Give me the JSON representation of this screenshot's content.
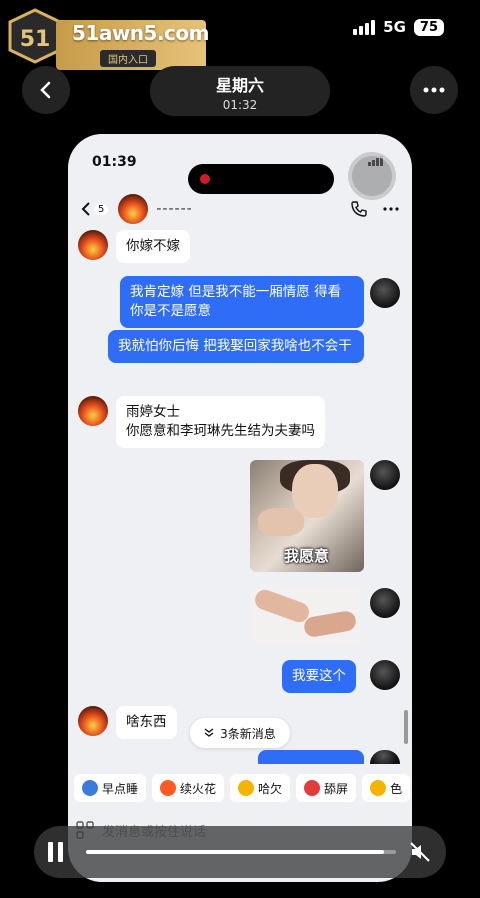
{
  "logo": {
    "text": "51awn5.com",
    "subtitle": "国内入口",
    "badge": "51"
  },
  "status": {
    "network": "5G",
    "battery": "75"
  },
  "header": {
    "title": "星期六",
    "subtitle": "01:32"
  },
  "phone": {
    "status": {
      "time": "01:39"
    },
    "chat": {
      "unread": "5",
      "contact_name": "------",
      "messages": [
        {
          "side": "in",
          "text": "你嫁不嫁"
        },
        {
          "side": "out",
          "text": "我肯定嫁 但是我不能一厢情愿 得看你是不是愿意"
        },
        {
          "side": "out",
          "text": "我就怕你后悔 把我娶回家我啥也不会干"
        },
        {
          "side": "in",
          "text": "雨婷女士\n你愿意和李珂琳先生结为夫妻吗"
        },
        {
          "side": "out",
          "type": "image",
          "caption": "我愿意"
        },
        {
          "side": "out",
          "type": "image"
        },
        {
          "side": "out",
          "text": "我要这个"
        },
        {
          "side": "in",
          "text": "啥东西"
        }
      ],
      "new_messages": "3条新消息",
      "quick_replies": [
        {
          "label": "早点睡",
          "icon": "earth-icon",
          "color": "#3b7bd9"
        },
        {
          "label": "续火花",
          "icon": "flame-icon",
          "color": "#ff5a1f"
        },
        {
          "label": "哈欠",
          "icon": "yawn-icon",
          "color": "#f5b400"
        },
        {
          "label": "舔屏",
          "icon": "lick-screen-icon",
          "color": "#e23b3b"
        },
        {
          "label": "色",
          "icon": "heart-eyes-icon",
          "color": "#f5b400"
        }
      ],
      "input_placeholder": "发消息或按住说话"
    }
  },
  "player": {
    "progress": 0.96
  }
}
